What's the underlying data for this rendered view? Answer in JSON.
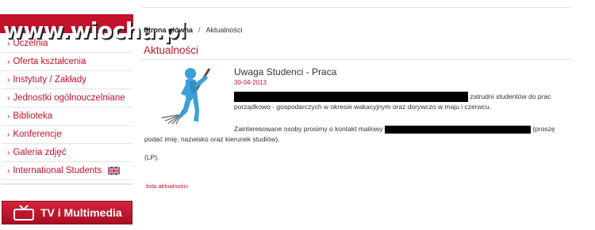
{
  "watermark": {
    "text": "www.wiocha.pl"
  },
  "sidebar": {
    "items": [
      {
        "label": "Uczelnia"
      },
      {
        "label": "Oferta kształcenia"
      },
      {
        "label": "Instytuty / Zakłady"
      },
      {
        "label": "Jednostki ogólnouczelniane"
      },
      {
        "label": "Biblioteka"
      },
      {
        "label": "Konferencje"
      },
      {
        "label": "Galeria zdjęć"
      },
      {
        "label": "International Students",
        "icon": "uk-flag-icon"
      }
    ],
    "bullet": "›",
    "tv_label": "TV i Multimedia"
  },
  "breadcrumb": {
    "home": "Strona główna",
    "separator": "/",
    "current": "Aktualności"
  },
  "page_title": "Aktualności",
  "article": {
    "title": "Uwaga Studenci - Praca",
    "date": "30-04-2013",
    "p1_line1_after_redaction": "zatrudni studentów do prac",
    "p1_line2": "porządkowo - gospodarczych w okresie wakacyjnym oraz dorywczo w maju i czerwcu.",
    "p2_before_redaction": "Zainteresowane osoby prosimy o kontakt mailowy",
    "p2_after_redaction": "(proszę",
    "p2_line2": "podać imię, nazwisko oraz kierunek studiów).",
    "p3": "(LP).",
    "back_link": "lista aktualności"
  },
  "colors": {
    "accent": "#c2122a",
    "text": "#333333",
    "redaction": "#000000"
  }
}
